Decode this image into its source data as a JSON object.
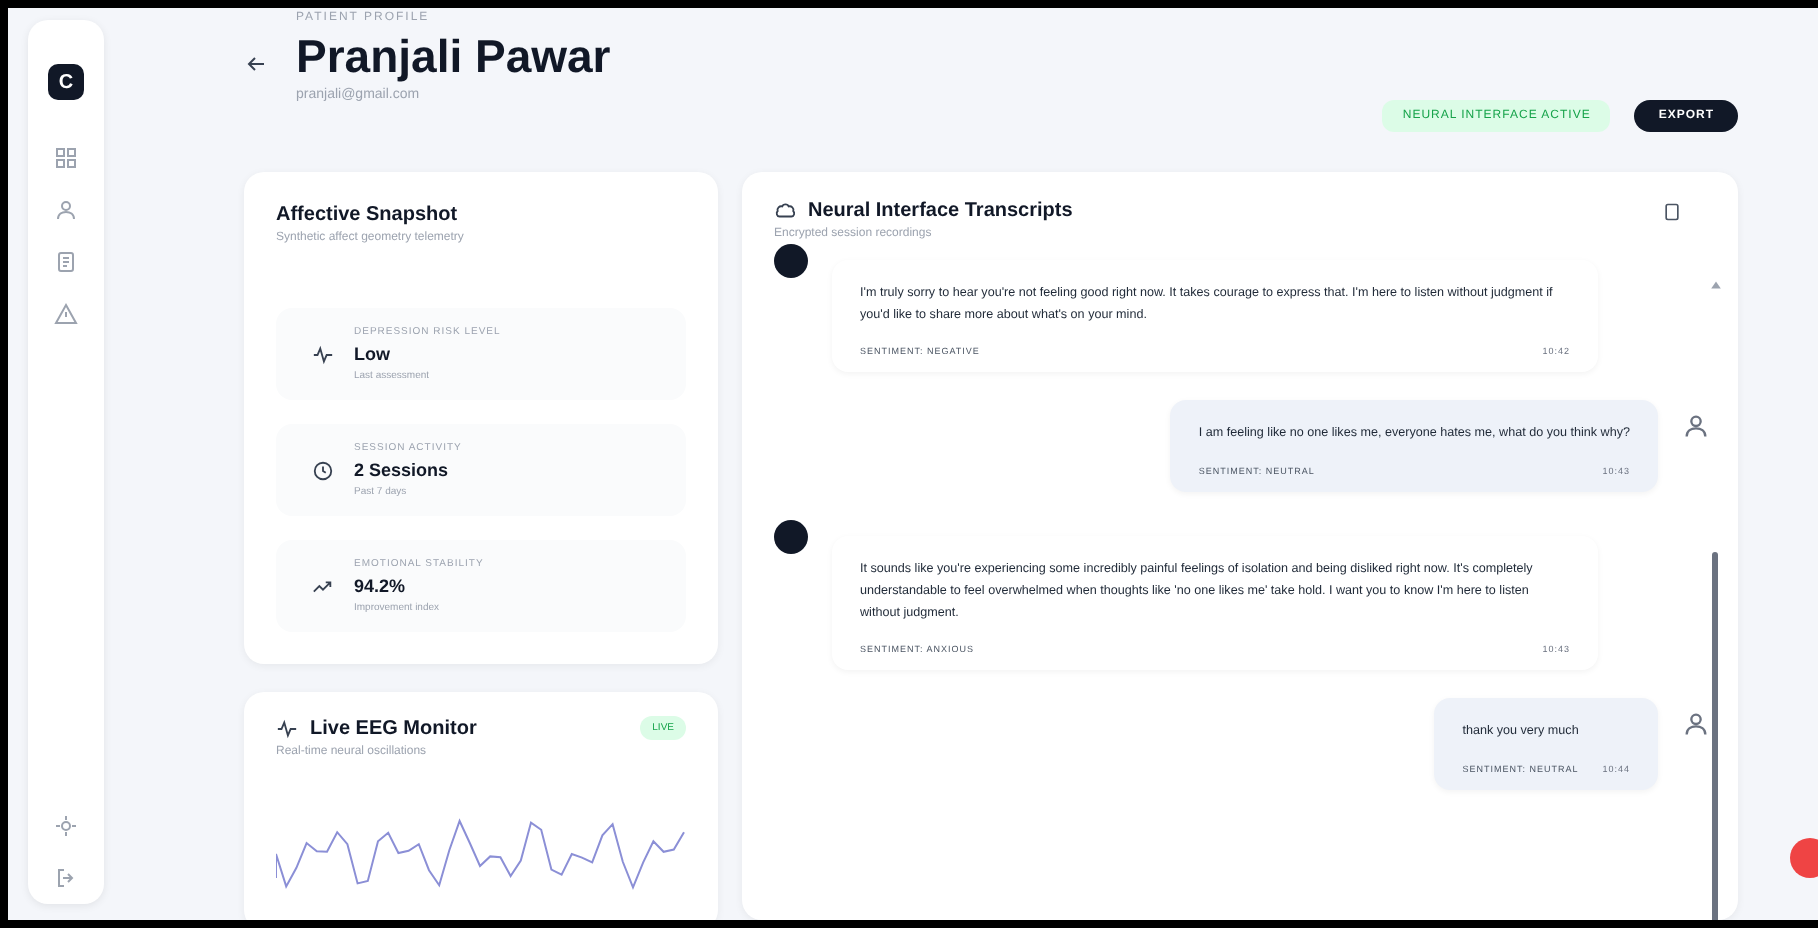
{
  "sidebar": {
    "logo": "C",
    "items": [
      {
        "kind": "grid"
      },
      {
        "kind": "users"
      },
      {
        "kind": "doc"
      },
      {
        "kind": "alert"
      }
    ],
    "bottom": [
      {
        "kind": "gear"
      },
      {
        "kind": "logout"
      }
    ]
  },
  "header": {
    "breadcrumb": "PATIENT PROFILE",
    "name": "Pranjali Pawar",
    "email": "pranjali@gmail.com",
    "status": "NEURAL INTERFACE ACTIVE",
    "action": "EXPORT"
  },
  "snapshot": {
    "title": "Affective Snapshot",
    "subtitle": "Synthetic affect geometry telemetry",
    "stats": [
      {
        "kind": "pulse",
        "label": "DEPRESSION RISK LEVEL",
        "value": "Low",
        "note": "Last assessment"
      },
      {
        "kind": "clock",
        "label": "SESSION ACTIVITY",
        "value": "2 Sessions",
        "note": "Past 7 days"
      },
      {
        "kind": "trend",
        "label": "EMOTIONAL STABILITY",
        "value": "94.2%",
        "note": "Improvement index"
      }
    ]
  },
  "eeg": {
    "title": "Live EEG Monitor",
    "subtitle": "Real-time neural oscillations",
    "badge": "LIVE"
  },
  "transcripts": {
    "title": "Neural Interface Transcripts",
    "subtitle": "Encrypted session recordings",
    "messages": [
      {
        "kind": "bot",
        "text": "I'm truly sorry to hear you're not feeling good right now. It takes courage to express that. I'm here to listen without judgment if you'd like to share more about what's on your mind.",
        "meta": "SENTIMENT: NEGATIVE",
        "time": "10:42"
      },
      {
        "kind": "user",
        "text": "I am feeling like no one likes me, everyone hates me, what do you think why?",
        "meta": "SENTIMENT: NEUTRAL",
        "time": "10:43"
      },
      {
        "kind": "bot",
        "text": "It sounds like you're experiencing some incredibly painful feelings of isolation and being disliked right now. It's completely understandable to feel overwhelmed when thoughts like 'no one likes me' take hold. I want you to know I'm here to listen without judgment.",
        "meta": "SENTIMENT: ANXIOUS",
        "time": "10:43"
      },
      {
        "kind": "user",
        "text": "thank you very much",
        "meta": "SENTIMENT: NEUTRAL",
        "time": "10:44"
      }
    ]
  }
}
